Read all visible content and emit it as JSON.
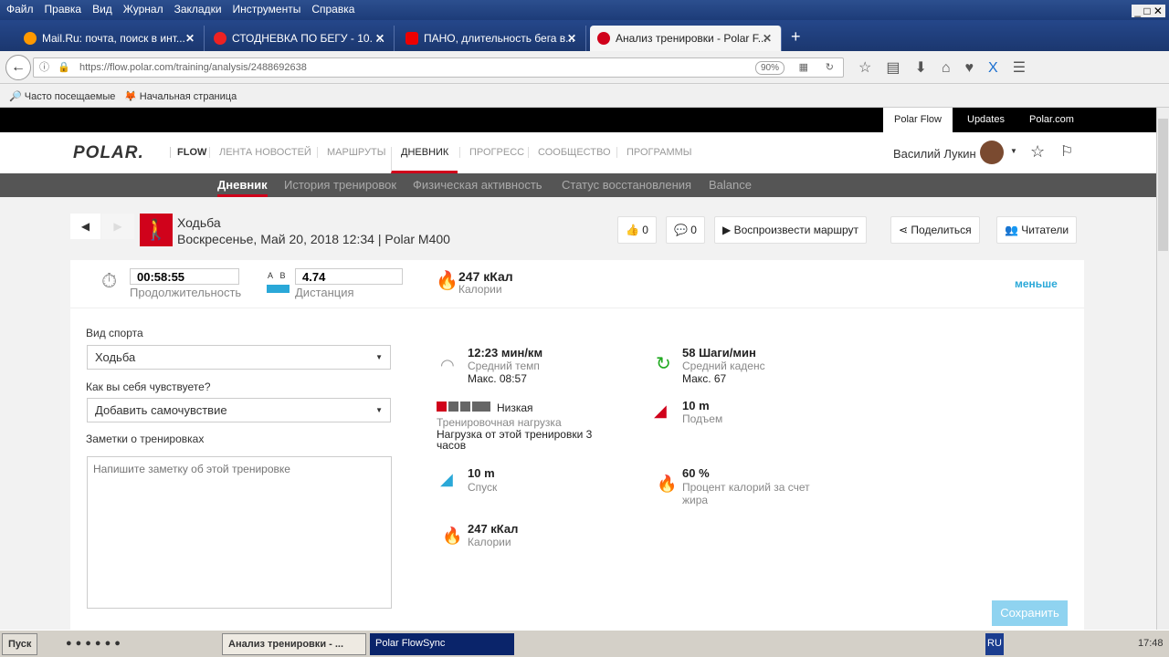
{
  "browser": {
    "menu": [
      "Файл",
      "Правка",
      "Вид",
      "Журнал",
      "Закладки",
      "Инструменты",
      "Справка"
    ],
    "tabs": [
      {
        "title": "Mail.Ru: почта, поиск в инт..."
      },
      {
        "title": "СТОДНЕВКА ПО БЕГУ - 10. ..."
      },
      {
        "title": "ПАНО, длительность бега в..."
      },
      {
        "title": "Анализ тренировки - Polar F..."
      }
    ],
    "url": "https://flow.polar.com/training/analysis/2488692638",
    "zoom": "90%",
    "bookmarks": [
      "Часто посещаемые",
      "Начальная страница"
    ]
  },
  "top_links": [
    "Polar Flow",
    "Updates",
    "Polar.com"
  ],
  "header": {
    "logo": "POLAR.",
    "flow": "FLOW",
    "nav": [
      "ЛЕНТА НОВОСТЕЙ",
      "МАРШРУТЫ",
      "ДНЕВНИК",
      "ПРОГРЕСС",
      "СООБЩЕСТВО",
      "ПРОГРАММЫ"
    ],
    "user": "Василий Лукин"
  },
  "subnav": [
    "Дневник",
    "История тренировок",
    "Физическая активность",
    "Статус восстановления",
    "Balance"
  ],
  "session": {
    "sport": "Ходьба",
    "date": "Воскресенье, Май 20, 2018 12:34 | Polar M400"
  },
  "actions": {
    "likes": "0",
    "comments": "0",
    "replay": "Воспроизвести маршрут",
    "share": "Поделиться",
    "readers": "Читатели"
  },
  "summary": {
    "duration": "00:58:55",
    "duration_label": "Продолжительность",
    "ab_a": "A",
    "ab_b": "B",
    "distance": "4.74",
    "distance_label": "Дистанция",
    "calories": "247 кКал",
    "calories_label": "Калории",
    "less": "меньше"
  },
  "form": {
    "sport_label": "Вид спорта",
    "sport_value": "Ходьба",
    "feeling_label": "Как вы себя чувствуете?",
    "feeling_value": "Добавить самочувствие",
    "notes_label": "Заметки о тренировках",
    "notes_placeholder": "Напишите заметку об этой тренировке",
    "save": "Сохранить"
  },
  "stats": {
    "pace": "12:23 мин/км",
    "pace_label": "Средний темп",
    "pace_max": "Макс. 08:57",
    "cadence": "58 Шаги/мин",
    "cadence_label": "Средний каденс",
    "cadence_max": "Макс. 67",
    "load_level": "Низкая",
    "load_label": "Тренировочная нагрузка",
    "load_desc": "Нагрузка от этой тренировки 3 часов",
    "load_fraction": 0.2,
    "ascent": "10 m",
    "ascent_label": "Подъем",
    "descent": "10 m",
    "descent_label": "Спуск",
    "fat": "60 %",
    "fat_label": "Процент калорий за счет жира",
    "calories": "247 кКал",
    "calories_label": "Калории"
  },
  "taskbar": {
    "start": "Пуск",
    "windows": [
      "Анализ тренировки - ...",
      "Polar FlowSync"
    ],
    "lang": "RU",
    "time": "17:48"
  },
  "colors": {
    "accent": "#d0021b",
    "link": "#2aa8d8",
    "save": "#8fd3f0"
  }
}
